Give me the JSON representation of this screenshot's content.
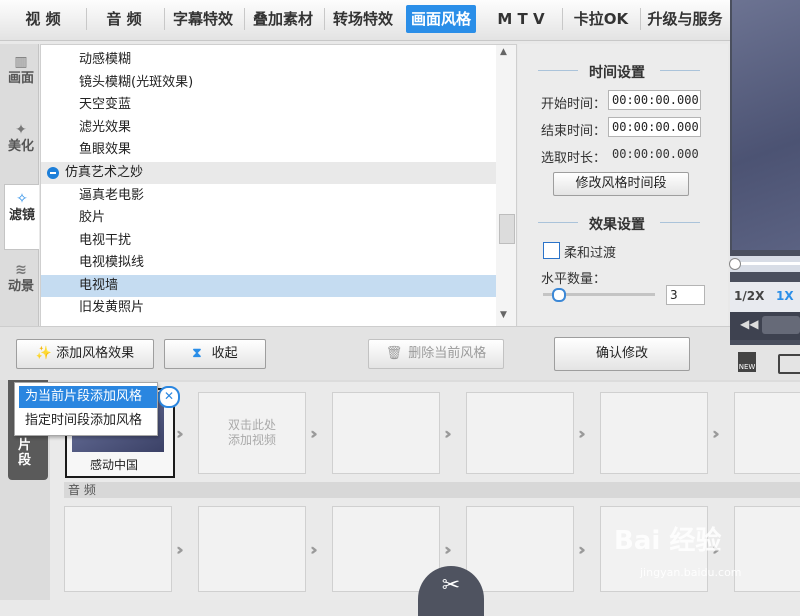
{
  "top_tabs": [
    "视 频",
    "音 频",
    "字幕特效",
    "叠加素材",
    "转场特效",
    "画面风格",
    "M T V",
    "卡拉OK",
    "升级与服务"
  ],
  "active_tab": "画面风格",
  "side_tabs": [
    {
      "label": "画面",
      "icon": "film-icon"
    },
    {
      "label": "美化",
      "icon": "magic-wand-icon"
    },
    {
      "label": "滤镜",
      "icon": "magic-stars-icon"
    },
    {
      "label": "动景",
      "icon": "wave-icon"
    }
  ],
  "effects_list": [
    {
      "label": "动感模糊",
      "kind": "item"
    },
    {
      "label": "镜头模糊(光斑效果)",
      "kind": "item"
    },
    {
      "label": "天空变蓝",
      "kind": "item"
    },
    {
      "label": "滤光效果",
      "kind": "item"
    },
    {
      "label": "鱼眼效果",
      "kind": "item"
    },
    {
      "label": "仿真艺术之妙",
      "kind": "group"
    },
    {
      "label": "逼真老电影",
      "kind": "item"
    },
    {
      "label": "胶片",
      "kind": "item"
    },
    {
      "label": "电视干扰",
      "kind": "item"
    },
    {
      "label": "电视模拟线",
      "kind": "item"
    },
    {
      "label": "电视墙",
      "kind": "selected"
    },
    {
      "label": "旧发黄照片",
      "kind": "item"
    }
  ],
  "settings": {
    "time_header": "时间设置",
    "start_label": "开始时间：",
    "start_value": "00:00:00.000",
    "end_label": "结束时间：",
    "end_value": "00:00:00.000",
    "duration_label": "选取时长：",
    "duration_value": "00:00:00.000",
    "modify_time_button": "修改风格时间段",
    "effect_header": "效果设置",
    "soft_transition_label": "柔和过渡",
    "horizontal_count_label": "水平数量：",
    "horizontal_count_value": "3",
    "horizontal_count_level": 0.1,
    "confirm_button": "确认修改"
  },
  "actions": {
    "add_effect": "添加风格效果",
    "collapse": "收起",
    "delete_current": "删除当前风格"
  },
  "popup_menu": [
    "为当前片段添加风格",
    "指定时间段添加风格"
  ],
  "timeline": {
    "clip_caption": "感动中国",
    "placeholder_text": "双击此处\n添加视频",
    "audio_label": "音 频",
    "left_strip_label": "片段"
  },
  "preview": {
    "speed_half": "1/2X",
    "speed_one": "1X"
  },
  "watermark": {
    "main": "Bai 经验",
    "sub": "jingyan.baidu.com"
  },
  "colors": {
    "accent": "#2a8ee8",
    "selected_row": "#c5dcf1"
  }
}
